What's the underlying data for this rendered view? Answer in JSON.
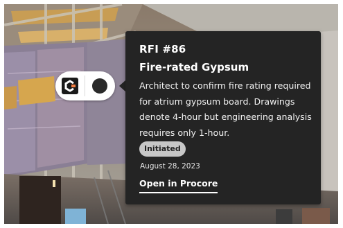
{
  "pin": {
    "logo_icon": "procore-logo-icon",
    "status_icon": "dot-icon",
    "colors": {
      "logo_accent": "#f47e42",
      "logo_dark": "#1a1a1a"
    }
  },
  "rfi": {
    "number": "RFI #86",
    "title": "Fire-rated Gypsum",
    "description": "Architect to confirm fire rating required for atrium gypsum board. Drawings denote 4-hour but engineering analysis requires only 1-hour.",
    "status": "Initiated",
    "date": "August 28, 2023",
    "open_link": "Open in Procore"
  },
  "colors": {
    "card_background": "#242424",
    "badge_background": "#c7c7c7",
    "text": "#ffffff"
  }
}
